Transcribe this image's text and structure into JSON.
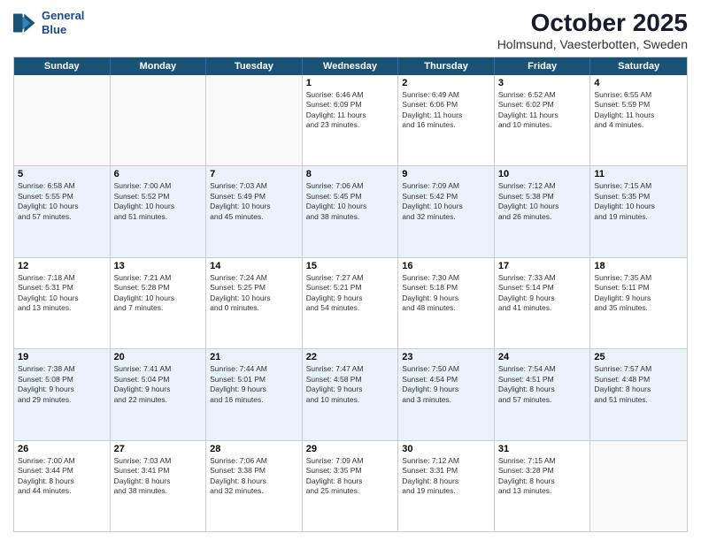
{
  "header": {
    "logo_line1": "General",
    "logo_line2": "Blue",
    "main_title": "October 2025",
    "sub_title": "Holmsund, Vaesterbotten, Sweden"
  },
  "days_of_week": [
    "Sunday",
    "Monday",
    "Tuesday",
    "Wednesday",
    "Thursday",
    "Friday",
    "Saturday"
  ],
  "rows": [
    {
      "alt": false,
      "cells": [
        {
          "day": "",
          "empty": true,
          "lines": []
        },
        {
          "day": "",
          "empty": true,
          "lines": []
        },
        {
          "day": "",
          "empty": true,
          "lines": []
        },
        {
          "day": "1",
          "empty": false,
          "lines": [
            "Sunrise: 6:46 AM",
            "Sunset: 6:09 PM",
            "Daylight: 11 hours",
            "and 23 minutes."
          ]
        },
        {
          "day": "2",
          "empty": false,
          "lines": [
            "Sunrise: 6:49 AM",
            "Sunset: 6:06 PM",
            "Daylight: 11 hours",
            "and 16 minutes."
          ]
        },
        {
          "day": "3",
          "empty": false,
          "lines": [
            "Sunrise: 6:52 AM",
            "Sunset: 6:02 PM",
            "Daylight: 11 hours",
            "and 10 minutes."
          ]
        },
        {
          "day": "4",
          "empty": false,
          "lines": [
            "Sunrise: 6:55 AM",
            "Sunset: 5:59 PM",
            "Daylight: 11 hours",
            "and 4 minutes."
          ]
        }
      ]
    },
    {
      "alt": true,
      "cells": [
        {
          "day": "5",
          "empty": false,
          "lines": [
            "Sunrise: 6:58 AM",
            "Sunset: 5:55 PM",
            "Daylight: 10 hours",
            "and 57 minutes."
          ]
        },
        {
          "day": "6",
          "empty": false,
          "lines": [
            "Sunrise: 7:00 AM",
            "Sunset: 5:52 PM",
            "Daylight: 10 hours",
            "and 51 minutes."
          ]
        },
        {
          "day": "7",
          "empty": false,
          "lines": [
            "Sunrise: 7:03 AM",
            "Sunset: 5:49 PM",
            "Daylight: 10 hours",
            "and 45 minutes."
          ]
        },
        {
          "day": "8",
          "empty": false,
          "lines": [
            "Sunrise: 7:06 AM",
            "Sunset: 5:45 PM",
            "Daylight: 10 hours",
            "and 38 minutes."
          ]
        },
        {
          "day": "9",
          "empty": false,
          "lines": [
            "Sunrise: 7:09 AM",
            "Sunset: 5:42 PM",
            "Daylight: 10 hours",
            "and 32 minutes."
          ]
        },
        {
          "day": "10",
          "empty": false,
          "lines": [
            "Sunrise: 7:12 AM",
            "Sunset: 5:38 PM",
            "Daylight: 10 hours",
            "and 26 minutes."
          ]
        },
        {
          "day": "11",
          "empty": false,
          "lines": [
            "Sunrise: 7:15 AM",
            "Sunset: 5:35 PM",
            "Daylight: 10 hours",
            "and 19 minutes."
          ]
        }
      ]
    },
    {
      "alt": false,
      "cells": [
        {
          "day": "12",
          "empty": false,
          "lines": [
            "Sunrise: 7:18 AM",
            "Sunset: 5:31 PM",
            "Daylight: 10 hours",
            "and 13 minutes."
          ]
        },
        {
          "day": "13",
          "empty": false,
          "lines": [
            "Sunrise: 7:21 AM",
            "Sunset: 5:28 PM",
            "Daylight: 10 hours",
            "and 7 minutes."
          ]
        },
        {
          "day": "14",
          "empty": false,
          "lines": [
            "Sunrise: 7:24 AM",
            "Sunset: 5:25 PM",
            "Daylight: 10 hours",
            "and 0 minutes."
          ]
        },
        {
          "day": "15",
          "empty": false,
          "lines": [
            "Sunrise: 7:27 AM",
            "Sunset: 5:21 PM",
            "Daylight: 9 hours",
            "and 54 minutes."
          ]
        },
        {
          "day": "16",
          "empty": false,
          "lines": [
            "Sunrise: 7:30 AM",
            "Sunset: 5:18 PM",
            "Daylight: 9 hours",
            "and 48 minutes."
          ]
        },
        {
          "day": "17",
          "empty": false,
          "lines": [
            "Sunrise: 7:33 AM",
            "Sunset: 5:14 PM",
            "Daylight: 9 hours",
            "and 41 minutes."
          ]
        },
        {
          "day": "18",
          "empty": false,
          "lines": [
            "Sunrise: 7:35 AM",
            "Sunset: 5:11 PM",
            "Daylight: 9 hours",
            "and 35 minutes."
          ]
        }
      ]
    },
    {
      "alt": true,
      "cells": [
        {
          "day": "19",
          "empty": false,
          "lines": [
            "Sunrise: 7:38 AM",
            "Sunset: 5:08 PM",
            "Daylight: 9 hours",
            "and 29 minutes."
          ]
        },
        {
          "day": "20",
          "empty": false,
          "lines": [
            "Sunrise: 7:41 AM",
            "Sunset: 5:04 PM",
            "Daylight: 9 hours",
            "and 22 minutes."
          ]
        },
        {
          "day": "21",
          "empty": false,
          "lines": [
            "Sunrise: 7:44 AM",
            "Sunset: 5:01 PM",
            "Daylight: 9 hours",
            "and 16 minutes."
          ]
        },
        {
          "day": "22",
          "empty": false,
          "lines": [
            "Sunrise: 7:47 AM",
            "Sunset: 4:58 PM",
            "Daylight: 9 hours",
            "and 10 minutes."
          ]
        },
        {
          "day": "23",
          "empty": false,
          "lines": [
            "Sunrise: 7:50 AM",
            "Sunset: 4:54 PM",
            "Daylight: 9 hours",
            "and 3 minutes."
          ]
        },
        {
          "day": "24",
          "empty": false,
          "lines": [
            "Sunrise: 7:54 AM",
            "Sunset: 4:51 PM",
            "Daylight: 8 hours",
            "and 57 minutes."
          ]
        },
        {
          "day": "25",
          "empty": false,
          "lines": [
            "Sunrise: 7:57 AM",
            "Sunset: 4:48 PM",
            "Daylight: 8 hours",
            "and 51 minutes."
          ]
        }
      ]
    },
    {
      "alt": false,
      "cells": [
        {
          "day": "26",
          "empty": false,
          "lines": [
            "Sunrise: 7:00 AM",
            "Sunset: 3:44 PM",
            "Daylight: 8 hours",
            "and 44 minutes."
          ]
        },
        {
          "day": "27",
          "empty": false,
          "lines": [
            "Sunrise: 7:03 AM",
            "Sunset: 3:41 PM",
            "Daylight: 8 hours",
            "and 38 minutes."
          ]
        },
        {
          "day": "28",
          "empty": false,
          "lines": [
            "Sunrise: 7:06 AM",
            "Sunset: 3:38 PM",
            "Daylight: 8 hours",
            "and 32 minutes."
          ]
        },
        {
          "day": "29",
          "empty": false,
          "lines": [
            "Sunrise: 7:09 AM",
            "Sunset: 3:35 PM",
            "Daylight: 8 hours",
            "and 25 minutes."
          ]
        },
        {
          "day": "30",
          "empty": false,
          "lines": [
            "Sunrise: 7:12 AM",
            "Sunset: 3:31 PM",
            "Daylight: 8 hours",
            "and 19 minutes."
          ]
        },
        {
          "day": "31",
          "empty": false,
          "lines": [
            "Sunrise: 7:15 AM",
            "Sunset: 3:28 PM",
            "Daylight: 8 hours",
            "and 13 minutes."
          ]
        },
        {
          "day": "",
          "empty": true,
          "lines": []
        }
      ]
    }
  ]
}
